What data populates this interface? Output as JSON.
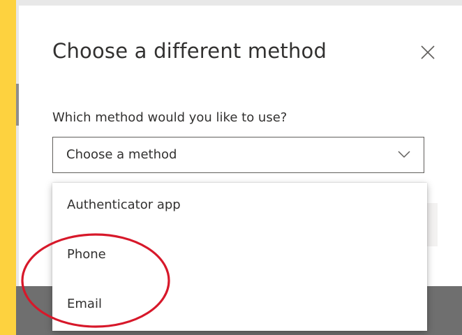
{
  "dialog": {
    "title": "Choose a different method",
    "close_icon": "close-icon",
    "field_label": "Which method would you like to use?",
    "select": {
      "selected_value": "Choose a method",
      "icon": "chevron-down-icon"
    }
  },
  "dropdown": {
    "options": [
      {
        "label": "Authenticator app"
      },
      {
        "label": "Phone"
      },
      {
        "label": "Email"
      }
    ]
  },
  "annotation": {
    "shape": "ellipse",
    "color": "#d7182a"
  },
  "colors": {
    "background_accent": "#fdd23f",
    "text": "#323130",
    "border": "#605e5c"
  }
}
